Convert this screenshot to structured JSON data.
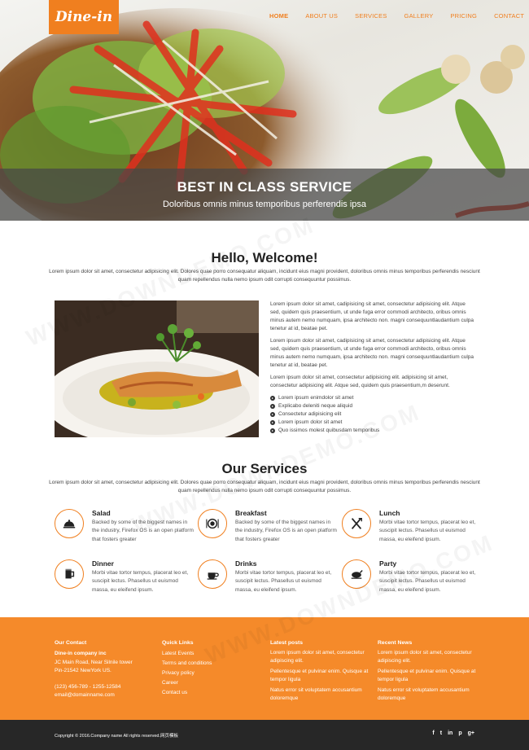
{
  "brand": {
    "logo": "Dine-in",
    "accent": "#f07f1f"
  },
  "nav": {
    "items": [
      "HOME",
      "ABOUT US",
      "SERVICES",
      "GALLERY",
      "PRICING",
      "CONTACT"
    ]
  },
  "hero": {
    "title": "BEST IN CLASS SERVICE",
    "subtitle": "Doloribus omnis minus temporibus perferendis ipsa"
  },
  "welcome": {
    "title": "Hello, Welcome!",
    "intro": "Lorem ipsum dolor sit amet, consectetur adipisicing elit. Dolores quae porro consequatur aliquam, incidunt eius magni provident, doloribus omnis minus temporibus perferendis nesciunt quam repellendus nulla nemo ipsum odit corrupti consequuntur possimus.",
    "p1": "Lorem ipsum dolor sit amet, cadipisicing sit amet, consectetur adipisicing elit. Atque sed, quidem quis praesentium, ut unde fuga error commodi architecto, oribus omnis minus autem nemo numquam, ipsa architecto non. magni consequuntlaudantium culpa tenetur at id, beatae pet.",
    "p2": "Lorem ipsum dolor sit amet, cadipisicing sit amet, consectetur adipisicing elit. Atque sed, quidem quis praesentium, ut unde fuga error commodi architecto, oribus omnis minus autem nemo numquam, ipsa architecto non. magni consequuntlaudantium culpa tenetur at id, beatae pet.",
    "p3": "Lorem ipsum dolor sit amet, consectetur adipisicing elit. adipisicing sit amet, consectetur adipisicing elit. Atque sed, quidem quis praesentium,m deserunt.",
    "list": [
      "Lorem ipsum enimdolor sit amet",
      "Explicabo deleniti neque aliquid",
      "Consectetur adipisicing elit",
      "Lorem ipsum dolor sit amet",
      "Quo issimos molest quibusdam temporibus"
    ]
  },
  "services": {
    "title": "Our Services",
    "intro": "Lorem ipsum dolor sit amet, consectetur adipisicing elit. Dolores quae porro consequatur aliquam, incidunt eius magni provident, doloribus omnis minus temporibus perferendis nesciunt quam repellendus nulla nemo ipsum odit corrupti consequuntur possimus.",
    "items": [
      {
        "name": "Salad",
        "icon": "cloche-icon",
        "desc": "Backed by some of the biggest names in the industry, Firefox OS is an open platform that fosters greater"
      },
      {
        "name": "Breakfast",
        "icon": "plate-cutlery-icon",
        "desc": "Backed by some of the biggest names in the industry, Firefox OS is an open platform that fosters greater"
      },
      {
        "name": "Lunch",
        "icon": "fork-knife-icon",
        "desc": "Morbi vitae tortor tempus, placerat leo et, suscipit lectus. Phasellus ut euismod massa, eu eleifend ipsum."
      },
      {
        "name": "Dinner",
        "icon": "beer-mug-icon",
        "desc": "Morbi vitae tortor tempus, placerat leo et, suscipit lectus. Phasellus ut euismod massa, eu eleifend ipsum."
      },
      {
        "name": "Drinks",
        "icon": "coffee-cup-icon",
        "desc": "Morbi vitae tortor tempus, placerat leo et, suscipit lectus. Phasellus ut euismod massa, eu eleifend ipsum."
      },
      {
        "name": "Party",
        "icon": "roast-chicken-icon",
        "desc": "Morbi vitae tortor tempus, placerat leo et, suscipit lectus. Phasellus ut euismod massa, eu eleifend ipsum."
      }
    ]
  },
  "footer": {
    "contact": {
      "heading": "Our Contact",
      "company": "Dine-in company inc",
      "address1": "JC Main Road, Near Silnile tower",
      "address2": "Pin-21542 NewYork US.",
      "phone": "(123) 456-789 - 1255-12584",
      "email": "email@domainname.com"
    },
    "quick": {
      "heading": "Quick Links",
      "links": [
        "Latest Events",
        "Terms and conditions",
        "Privacy policy",
        "Career",
        "Contact us"
      ]
    },
    "latest": {
      "heading": "Latest posts",
      "posts": [
        "Lorem ipsum dolor sit amet, consectetur adipiscing elit.",
        "Pellentesque et pulvinar enim. Quisque at tempor ligula",
        "Natus error sit voluptatem accusantium doloremque"
      ]
    },
    "recent": {
      "heading": "Recent News",
      "posts": [
        "Lorem ipsum dolor sit amet, consectetur adipiscing elit.",
        "Pellentesque et pulvinar enim. Quisque at tempor ligula",
        "Natus error sit voluptatem accusantium doloremque"
      ]
    },
    "copyright": "Copyright © 2016.Company name All rights reserved.网页模板",
    "social": [
      "f",
      "t",
      "in",
      "p",
      "g+"
    ]
  },
  "watermark": "WWW.DOWNDEMO.COM"
}
